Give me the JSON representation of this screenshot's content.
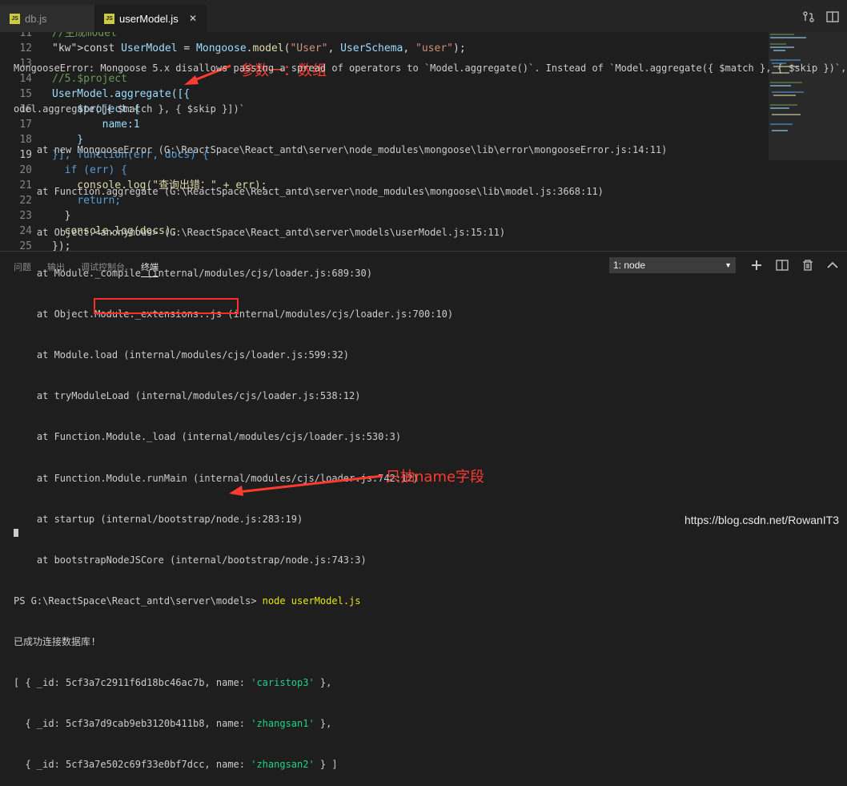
{
  "tabs": [
    {
      "label": "db.js",
      "icon": "js-file-icon",
      "badge": "JS"
    },
    {
      "label": "userModel.js",
      "icon": "js-file-icon",
      "badge": "JS",
      "close": "✕"
    }
  ],
  "top_icons": [
    "source-control-icon",
    "split-editor-icon"
  ],
  "editor": {
    "lines": [
      {
        "n": "11",
        "text": "//生成model"
      },
      {
        "n": "12",
        "text": "const UserModel = Mongoose.model(\"User\", UserSchema, \"user\");"
      },
      {
        "n": "13",
        "text": ""
      },
      {
        "n": "14",
        "text": "//5.$project"
      },
      {
        "n": "15",
        "text": "UserModel.aggregate([{"
      },
      {
        "n": "16",
        "text": "    $project:{"
      },
      {
        "n": "17",
        "text": "        name:1"
      },
      {
        "n": "18",
        "text": "    }"
      },
      {
        "n": "19",
        "text": "}], function(err, docs) {"
      },
      {
        "n": "20",
        "text": "  if (err) {"
      },
      {
        "n": "21",
        "text": "    console.log(\"查询出错：\" + err);"
      },
      {
        "n": "22",
        "text": "    return;"
      },
      {
        "n": "23",
        "text": "  }"
      },
      {
        "n": "24",
        "text": "  console.log(docs);"
      },
      {
        "n": "25",
        "text": "});"
      }
    ],
    "annotation": "参数一：数组"
  },
  "panel": {
    "tabs": [
      "问题",
      "输出",
      "调试控制台",
      "终端"
    ],
    "active_tab": "终端",
    "terminal_select": "1: node",
    "icons": [
      "add-terminal-icon",
      "split-terminal-icon",
      "trash-icon",
      "chevron-up-icon"
    ]
  },
  "terminal": {
    "lines": [
      "MongooseError: Mongoose 5.x disallows passing a spread of operators to `Model.aggregate()`. Instead of `Model.aggregate({ $match }, { $skip })`, do `M",
      "odel.aggregate([{ $match }, { $skip }])`",
      "    at new MongooseError (G:\\ReactSpace\\React_antd\\server\\node_modules\\mongoose\\lib\\error\\mongooseError.js:14:11)",
      "    at Function.aggregate (G:\\ReactSpace\\React_antd\\server\\node_modules\\mongoose\\lib\\model.js:3668:11)",
      "    at Object.<anonymous> (G:\\ReactSpace\\React_antd\\server\\models\\userModel.js:15:11)",
      "    at Module._compile (internal/modules/cjs/loader.js:689:30)",
      "    at Object.Module._extensions..js (internal/modules/cjs/loader.js:700:10)",
      "    at Module.load (internal/modules/cjs/loader.js:599:32)",
      "    at tryModuleLoad (internal/modules/cjs/loader.js:538:12)",
      "    at Function.Module._load (internal/modules/cjs/loader.js:530:3)",
      "    at Function.Module.runMain (internal/modules/cjs/loader.js:742:12)",
      "    at startup (internal/bootstrap/node.js:283:19)",
      "    at bootstrapNodeJSCore (internal/bootstrap/node.js:743:3)"
    ],
    "prompt": "PS G:\\ReactSpace\\React_antd\\server\\models> ",
    "command": "node userModel.js",
    "connected": "已成功连接数据库!",
    "results": [
      {
        "prefix": "[ { _id: ",
        "id": "5cf3a7c2911f6d18bc46ac7b",
        "name": "'caristop3'",
        "suffix": " },"
      },
      {
        "prefix": "  { _id: ",
        "id": "5cf3a7d9cab9eb3120b411b8",
        "name": "'zhangsan1'",
        "suffix": " },"
      },
      {
        "prefix": "  { _id: ",
        "id": "5cf3a7e502c69f33e0bf7dcc",
        "name": "'zhangsan2'",
        "suffix": " } ]"
      }
    ],
    "name_label": ", name: ",
    "annotation": "只抽name字段"
  },
  "watermark": "https://blog.csdn.net/RowanIT3",
  "colors": {
    "annotation": "#ff3b30",
    "string": "#ce9178",
    "keyword": "#569cd6",
    "class": "#4ec9b0"
  }
}
